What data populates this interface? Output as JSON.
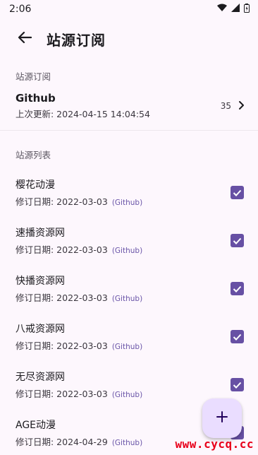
{
  "status_bar": {
    "time": "2:06"
  },
  "app_bar": {
    "title": "站源订阅"
  },
  "subscription_section": {
    "label": "站源订阅",
    "item": {
      "name": "Github",
      "updated": "上次更新: 2024-04-15 14:04:54",
      "count": "35"
    }
  },
  "list_section": {
    "label": "站源列表",
    "items": [
      {
        "name": "樱花动漫",
        "date": "修订日期: 2022-03-03",
        "source": "(Github)",
        "checked": true
      },
      {
        "name": "速播资源网",
        "date": "修订日期: 2022-03-03",
        "source": "(Github)",
        "checked": true
      },
      {
        "name": "快播资源网",
        "date": "修订日期: 2022-03-03",
        "source": "(Github)",
        "checked": true
      },
      {
        "name": "八戒资源网",
        "date": "修订日期: 2022-03-03",
        "source": "(Github)",
        "checked": true
      },
      {
        "name": "无尽资源网",
        "date": "修订日期: 2022-03-03",
        "source": "(Github)",
        "checked": true
      },
      {
        "name": "AGE动漫",
        "date": "修订日期: 2024-04-29",
        "source": "(Github)",
        "checked": true
      }
    ]
  },
  "fab": {
    "icon": "plus-icon"
  },
  "watermark": "www.cycq.cc",
  "colors": {
    "accent": "#6750a4",
    "background": "#fdf7fd",
    "fab": "#eaddff"
  }
}
